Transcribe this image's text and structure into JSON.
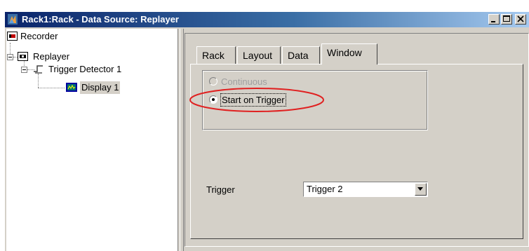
{
  "window": {
    "title": "Rack1:Rack - Data Source: Replayer",
    "app_icon": "app-icon",
    "controls": [
      "minimize-icon",
      "maximize-icon",
      "close-icon"
    ]
  },
  "tree": {
    "items": [
      {
        "label": "Recorder",
        "icon": "recorder-icon",
        "level": 0
      },
      {
        "label": "Replayer",
        "icon": "replayer-icon",
        "level": 0,
        "expanded": true
      },
      {
        "label": "Trigger Detector 1",
        "icon": "trigger-detector-icon",
        "level": 1,
        "expanded": true
      },
      {
        "label": "Display 1",
        "icon": "display-icon",
        "level": 2,
        "selected": true
      }
    ]
  },
  "tabs": [
    {
      "label": "Rack"
    },
    {
      "label": "Layout"
    },
    {
      "label": "Data"
    },
    {
      "label": "Window",
      "active": true
    }
  ],
  "window_tab": {
    "options": [
      {
        "label": "Continuous",
        "selected": false,
        "enabled": false
      },
      {
        "label": "Start on Trigger",
        "selected": true,
        "enabled": true
      }
    ],
    "trigger_label": "Trigger",
    "trigger_value": "Trigger 2"
  },
  "colors": {
    "titlebar_start": "#0a246a",
    "titlebar_end": "#a6caf0",
    "face": "#d4d0c8",
    "highlight_ellipse": "#e02020"
  }
}
